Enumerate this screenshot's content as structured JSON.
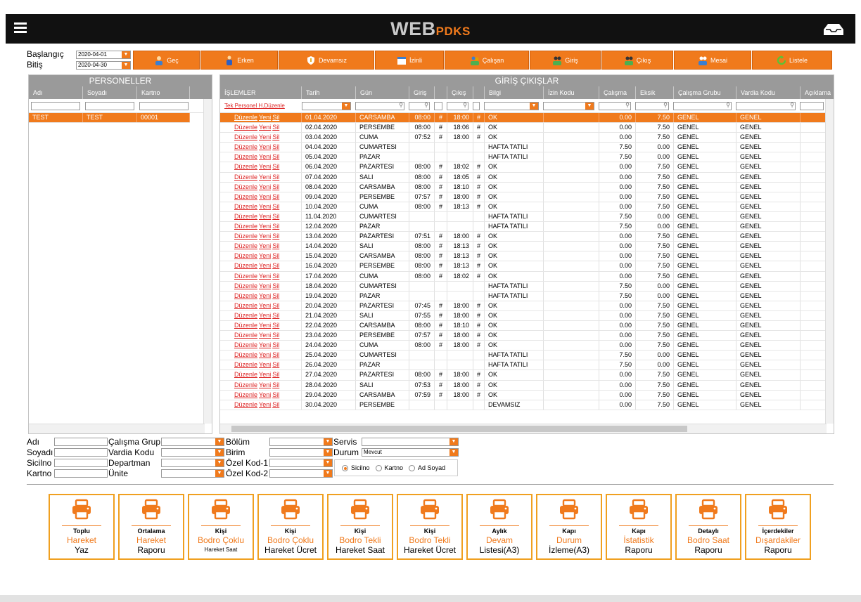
{
  "brand": {
    "a": "WEB",
    "b": "PDKS"
  },
  "dates": {
    "start_label": "Başlangıç",
    "start": "2020-04-01",
    "end_label": "Bitiş",
    "end": "2020-04-30"
  },
  "toolbar": [
    "Geç",
    "Erken",
    "Devamsız",
    "İzinli",
    "Çalışan",
    "Giriş",
    "Çıkış",
    "Mesai",
    "Listele"
  ],
  "personnel": {
    "title": "PERSONELLER",
    "cols": [
      "Adı",
      "Soyadı",
      "Kartno"
    ],
    "rows": [
      [
        "TEST",
        "TEST",
        "00001"
      ]
    ]
  },
  "grid": {
    "title": "GİRİŞ ÇIKIŞLAR",
    "cols": [
      "İŞLEMLER",
      "Tarih",
      "Gün",
      "Giriş",
      "",
      "Çıkış",
      "",
      "Bilgi",
      "İzin Kodu",
      "Çalışma",
      "Eksik",
      "Çalışma Grubu",
      "Vardia Kodu",
      "Açıklama"
    ],
    "filter_link": "Tek Personel H.Düzenle",
    "actions": [
      "Düzenle",
      "Yeni",
      "Sil"
    ],
    "rows": [
      [
        "01.04.2020",
        "CARSAMBA",
        "08:00",
        "#",
        "18:00",
        "#",
        "OK",
        "",
        "0.00",
        "7.50",
        "GENEL",
        "GENEL"
      ],
      [
        "02.04.2020",
        "PERSEMBE",
        "08:00",
        "#",
        "18:06",
        "#",
        "OK",
        "",
        "0.00",
        "7.50",
        "GENEL",
        "GENEL"
      ],
      [
        "03.04.2020",
        "CUMA",
        "07:52",
        "#",
        "18:00",
        "#",
        "OK",
        "",
        "0.00",
        "7.50",
        "GENEL",
        "GENEL"
      ],
      [
        "04.04.2020",
        "CUMARTESI",
        "",
        "",
        "",
        "",
        "HAFTA TATILI",
        "",
        "7.50",
        "0.00",
        "GENEL",
        "GENEL"
      ],
      [
        "05.04.2020",
        "PAZAR",
        "",
        "",
        "",
        "",
        "HAFTA TATILI",
        "",
        "7.50",
        "0.00",
        "GENEL",
        "GENEL"
      ],
      [
        "06.04.2020",
        "PAZARTESI",
        "08:00",
        "#",
        "18:02",
        "#",
        "OK",
        "",
        "0.00",
        "7.50",
        "GENEL",
        "GENEL"
      ],
      [
        "07.04.2020",
        "SALI",
        "08:00",
        "#",
        "18:05",
        "#",
        "OK",
        "",
        "0.00",
        "7.50",
        "GENEL",
        "GENEL"
      ],
      [
        "08.04.2020",
        "CARSAMBA",
        "08:00",
        "#",
        "18:10",
        "#",
        "OK",
        "",
        "0.00",
        "7.50",
        "GENEL",
        "GENEL"
      ],
      [
        "09.04.2020",
        "PERSEMBE",
        "07:57",
        "#",
        "18:00",
        "#",
        "OK",
        "",
        "0.00",
        "7.50",
        "GENEL",
        "GENEL"
      ],
      [
        "10.04.2020",
        "CUMA",
        "08:00",
        "#",
        "18:13",
        "#",
        "OK",
        "",
        "0.00",
        "7.50",
        "GENEL",
        "GENEL"
      ],
      [
        "11.04.2020",
        "CUMARTESI",
        "",
        "",
        "",
        "",
        "HAFTA TATILI",
        "",
        "7.50",
        "0.00",
        "GENEL",
        "GENEL"
      ],
      [
        "12.04.2020",
        "PAZAR",
        "",
        "",
        "",
        "",
        "HAFTA TATILI",
        "",
        "7.50",
        "0.00",
        "GENEL",
        "GENEL"
      ],
      [
        "13.04.2020",
        "PAZARTESI",
        "07:51",
        "#",
        "18:00",
        "#",
        "OK",
        "",
        "0.00",
        "7.50",
        "GENEL",
        "GENEL"
      ],
      [
        "14.04.2020",
        "SALI",
        "08:00",
        "#",
        "18:13",
        "#",
        "OK",
        "",
        "0.00",
        "7.50",
        "GENEL",
        "GENEL"
      ],
      [
        "15.04.2020",
        "CARSAMBA",
        "08:00",
        "#",
        "18:13",
        "#",
        "OK",
        "",
        "0.00",
        "7.50",
        "GENEL",
        "GENEL"
      ],
      [
        "16.04.2020",
        "PERSEMBE",
        "08:00",
        "#",
        "18:13",
        "#",
        "OK",
        "",
        "0.00",
        "7.50",
        "GENEL",
        "GENEL"
      ],
      [
        "17.04.2020",
        "CUMA",
        "08:00",
        "#",
        "18:02",
        "#",
        "OK",
        "",
        "0.00",
        "7.50",
        "GENEL",
        "GENEL"
      ],
      [
        "18.04.2020",
        "CUMARTESI",
        "",
        "",
        "",
        "",
        "HAFTA TATILI",
        "",
        "7.50",
        "0.00",
        "GENEL",
        "GENEL"
      ],
      [
        "19.04.2020",
        "PAZAR",
        "",
        "",
        "",
        "",
        "HAFTA TATILI",
        "",
        "7.50",
        "0.00",
        "GENEL",
        "GENEL"
      ],
      [
        "20.04.2020",
        "PAZARTESI",
        "07:45",
        "#",
        "18:00",
        "#",
        "OK",
        "",
        "0.00",
        "7.50",
        "GENEL",
        "GENEL"
      ],
      [
        "21.04.2020",
        "SALI",
        "07:55",
        "#",
        "18:00",
        "#",
        "OK",
        "",
        "0.00",
        "7.50",
        "GENEL",
        "GENEL"
      ],
      [
        "22.04.2020",
        "CARSAMBA",
        "08:00",
        "#",
        "18:10",
        "#",
        "OK",
        "",
        "0.00",
        "7.50",
        "GENEL",
        "GENEL"
      ],
      [
        "23.04.2020",
        "PERSEMBE",
        "07:57",
        "#",
        "18:00",
        "#",
        "OK",
        "",
        "0.00",
        "7.50",
        "GENEL",
        "GENEL"
      ],
      [
        "24.04.2020",
        "CUMA",
        "08:00",
        "#",
        "18:00",
        "#",
        "OK",
        "",
        "0.00",
        "7.50",
        "GENEL",
        "GENEL"
      ],
      [
        "25.04.2020",
        "CUMARTESI",
        "",
        "",
        "",
        "",
        "HAFTA TATILI",
        "",
        "7.50",
        "0.00",
        "GENEL",
        "GENEL"
      ],
      [
        "26.04.2020",
        "PAZAR",
        "",
        "",
        "",
        "",
        "HAFTA TATILI",
        "",
        "7.50",
        "0.00",
        "GENEL",
        "GENEL"
      ],
      [
        "27.04.2020",
        "PAZARTESI",
        "08:00",
        "#",
        "18:00",
        "#",
        "OK",
        "",
        "0.00",
        "7.50",
        "GENEL",
        "GENEL"
      ],
      [
        "28.04.2020",
        "SALI",
        "07:53",
        "#",
        "18:00",
        "#",
        "OK",
        "",
        "0.00",
        "7.50",
        "GENEL",
        "GENEL"
      ],
      [
        "29.04.2020",
        "CARSAMBA",
        "07:59",
        "#",
        "18:00",
        "#",
        "OK",
        "",
        "0.00",
        "7.50",
        "GENEL",
        "GENEL"
      ],
      [
        "30.04.2020",
        "PERSEMBE",
        "",
        "",
        "",
        "",
        "DEVAMSIZ",
        "",
        "0.00",
        "7.50",
        "GENEL",
        "GENEL"
      ]
    ]
  },
  "filters": {
    "adi": "Adı",
    "soyadi": "Soyadı",
    "sicilno": "Sicilno",
    "kartno": "Kartno",
    "calisma_grup": "Çalışma Grup",
    "vardia_kodu": "Vardia Kodu",
    "departman": "Departman",
    "unite": "Ünite",
    "bolum": "Bölüm",
    "birim": "Birim",
    "ozel1": "Özel Kod-1",
    "ozel2": "Özel Kod-2",
    "servis": "Servis",
    "durum": "Durum",
    "durum_value": "Mevcut",
    "radios": [
      "Sicilno",
      "Kartno",
      "Ad Soyad"
    ]
  },
  "reports": [
    {
      "l1": "Toplu",
      "l2": "Hareket",
      "l3": "Yaz"
    },
    {
      "l1": "Ortalama",
      "l2": "Hareket",
      "l3": "Raporu"
    },
    {
      "l1": "Kişi",
      "l2": "Bodro Çoklu",
      "l3": "Hareket Saat"
    },
    {
      "l1": "Kişi",
      "l2": "Bodro Çoklu",
      "l3": "Hareket Ücret"
    },
    {
      "l1": "Kişi",
      "l2": "Bodro Tekli",
      "l3": "Hareket Saat"
    },
    {
      "l1": "Kişi",
      "l2": "Bodro Tekli",
      "l3": "Hareket Ücret"
    },
    {
      "l1": "Aylık",
      "l2": "Devam",
      "l3": "Listesi(A3)"
    },
    {
      "l1": "Kapı",
      "l2": "Durum",
      "l3": "İzleme(A3)"
    },
    {
      "l1": "Kapı",
      "l2": "İstatistik",
      "l3": "Raporu"
    },
    {
      "l1": "Detaylı",
      "l2": "Bodro Saat",
      "l3": "Raporu"
    },
    {
      "l1": "İçerdekiler",
      "l2": "Dışardakiler",
      "l3": "Raporu"
    }
  ],
  "colors": {
    "accent": "#f07a1c",
    "header": "#111111",
    "grid_header": "#9a9a9a"
  }
}
